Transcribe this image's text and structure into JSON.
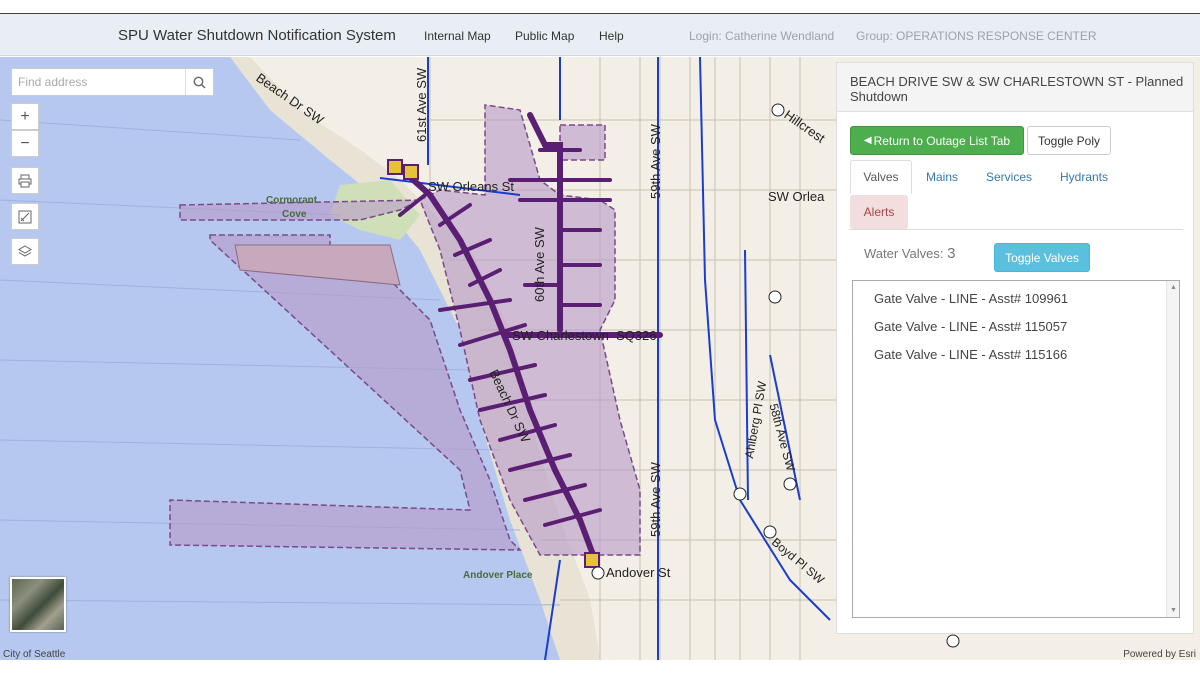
{
  "topbar": {
    "title": "SPU Water Shutdown Notification System",
    "nav_internal": "Internal Map",
    "nav_public": "Public Map",
    "nav_help": "Help",
    "login": "Login: Catherine Wendland",
    "group": "Group: OPERATIONS RESPONSE CENTER"
  },
  "map": {
    "search_placeholder": "Find address",
    "labels": {
      "beach_dr": "Beach Dr SW",
      "ave61": "61st Ave SW",
      "orleans": "SW Orleans St",
      "ave60": "60th Ave SW",
      "charlestown": "SW Charlestown",
      "sq": "SQ326",
      "beach_dr2": "Beach Dr SW",
      "andover": "Andover St",
      "ave59": "59th Ave SW",
      "ave59b": "59th Ave SW",
      "hillcrest": "Hillcrest",
      "orleans2": "SW Orlea",
      "ahlberg": "Ahlberg Pl SW",
      "ave58": "58th Ave SW",
      "boyd": "Boyd Pl SW",
      "cormorant": "Cormorant",
      "cove": "Cove",
      "andover_place": "Andover Place"
    },
    "attribution_left": "City of Seattle",
    "attribution_right": "Powered by Esri"
  },
  "panel": {
    "title": "BEACH DRIVE SW & SW CHARLESTOWN ST - Planned Shutdown",
    "return_button": "Return to Outage List Tab",
    "toggle_poly": "Toggle Poly",
    "tabs": [
      "Valves",
      "Mains",
      "Services",
      "Hydrants",
      "Alerts"
    ],
    "water_valves_label": "Water Valves:",
    "water_valves_count": "3",
    "toggle_valves": "Toggle Valves",
    "valves": [
      "Gate Valve - LINE - Asst# 109961",
      "Gate Valve - LINE - Asst# 115057",
      "Gate Valve - LINE - Asst# 115166"
    ]
  },
  "colors": {
    "water": "#b6c8f0",
    "land": "#f3efe6",
    "outage_poly": "#c8a6c8",
    "main_line": "#5a1e73",
    "pipe_blue": "#1a3ccf",
    "accent_green": "#4cae4c",
    "accent_info": "#5bc0de"
  }
}
